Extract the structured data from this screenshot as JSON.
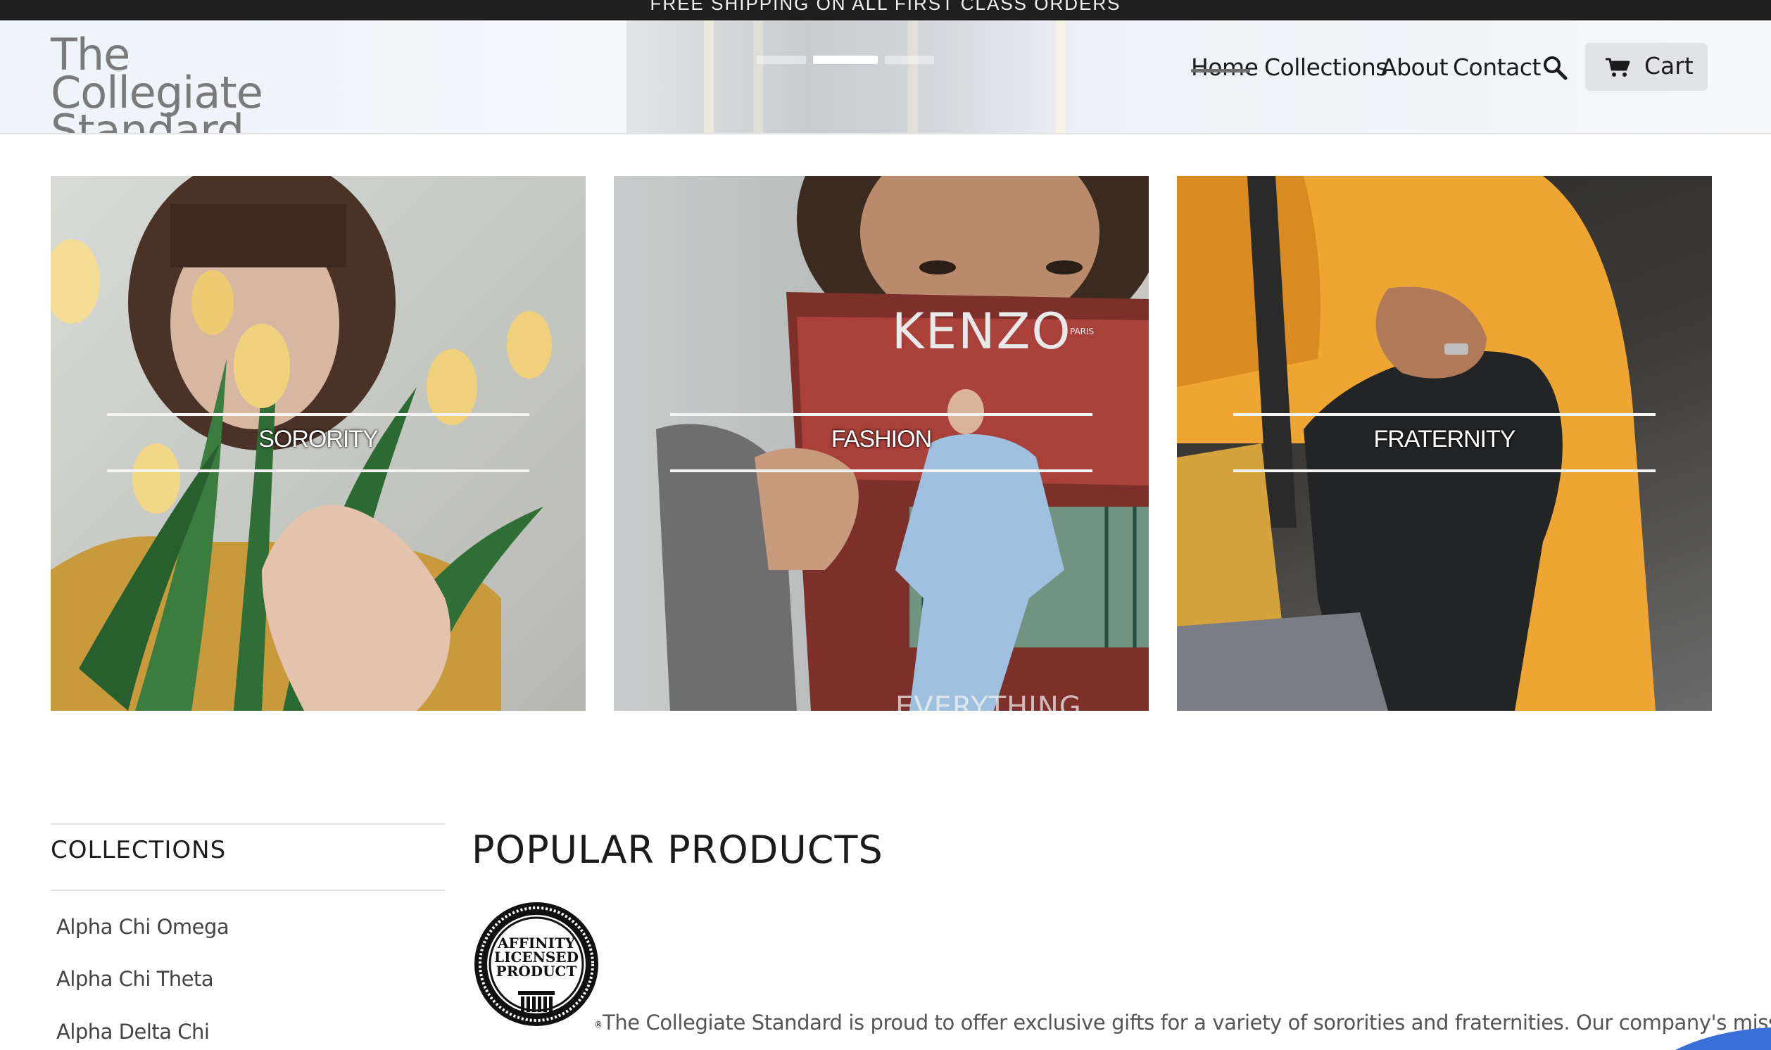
{
  "announcement": {
    "text": "FREE SHIPPING ON ALL FIRST CLASS ORDERS"
  },
  "header": {
    "logo": "The Collegiate Standard",
    "nav": [
      {
        "label": "Home",
        "active": true
      },
      {
        "label": "Collections"
      },
      {
        "label": "About"
      },
      {
        "label": "Contact"
      }
    ],
    "search_icon": "search-icon",
    "cart": {
      "label": "Cart",
      "icon": "cart-icon"
    },
    "slider": {
      "slides": 3,
      "active_slide": 2
    }
  },
  "tiles": [
    {
      "label": "SORORITY"
    },
    {
      "label": "FASHION",
      "magazine_title": "KENZO",
      "magazine_sub": "PARIS",
      "magazine_bottom": "EVERYTHING"
    },
    {
      "label": "FRATERNITY"
    }
  ],
  "sidebar": {
    "title": "COLLECTIONS",
    "items": [
      "Alpha Chi Omega",
      "Alpha Chi Theta",
      "Alpha Delta Chi"
    ]
  },
  "main": {
    "title": "POPULAR PRODUCTS",
    "badge": {
      "lines": [
        "AFFINITY",
        "LICENSED",
        "PRODUCT"
      ]
    },
    "intro": "The Collegiate Standard is proud to offer exclusive gifts for a variety of sororities and fraternities. Our company's mission is"
  },
  "colors": {
    "announcement_bg": "#1f1f1f",
    "cart_bg": "#e1e3e6",
    "accent_blue": "#3a6fd8"
  }
}
